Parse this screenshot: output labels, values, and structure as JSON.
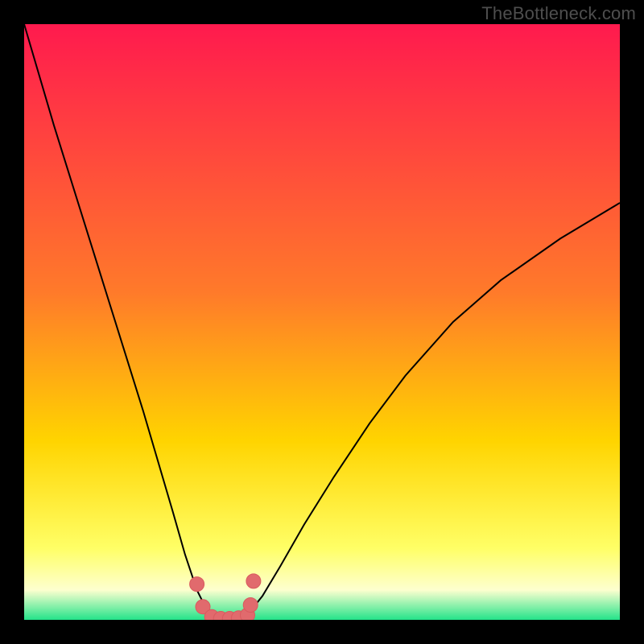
{
  "watermark": "TheBottleneck.com",
  "colors": {
    "frame": "#000000",
    "grad_top": "#ff1a4e",
    "grad_mid1": "#ff7a2a",
    "grad_mid2": "#ffd400",
    "grad_mid3": "#ffff66",
    "grad_bot1": "#fdffcf",
    "grad_bot2": "#24e38a",
    "curve": "#000000",
    "marker_fill": "#e16a6d",
    "marker_stroke": "#d95a5e"
  },
  "chart_data": {
    "type": "line",
    "title": "",
    "xlabel": "",
    "ylabel": "",
    "xlim": [
      0,
      100
    ],
    "ylim": [
      0,
      100
    ],
    "series": [
      {
        "name": "bottleneck-curve",
        "x": [
          0,
          5,
          10,
          15,
          20,
          25,
          27,
          29,
          30.5,
          32,
          33,
          34,
          35,
          36,
          37,
          38,
          40,
          43,
          47,
          52,
          58,
          64,
          72,
          80,
          90,
          100
        ],
        "values": [
          100,
          83,
          67,
          51,
          35,
          18,
          11,
          5,
          2,
          0.6,
          0.2,
          0.15,
          0.15,
          0.2,
          0.6,
          1.5,
          4,
          9,
          16,
          24,
          33,
          41,
          50,
          57,
          64,
          70
        ]
      }
    ],
    "markers": [
      {
        "x": 29.0,
        "y": 6.0
      },
      {
        "x": 30.0,
        "y": 2.2
      },
      {
        "x": 31.5,
        "y": 0.5
      },
      {
        "x": 33.0,
        "y": 0.2
      },
      {
        "x": 34.5,
        "y": 0.2
      },
      {
        "x": 36.0,
        "y": 0.3
      },
      {
        "x": 37.5,
        "y": 0.8
      },
      {
        "x": 38.0,
        "y": 2.5
      },
      {
        "x": 38.5,
        "y": 6.5
      }
    ],
    "gradient_bands": [
      {
        "y": 100,
        "color": "#ff1a4e"
      },
      {
        "y": 55,
        "color": "#ff7a2a"
      },
      {
        "y": 30,
        "color": "#ffd400"
      },
      {
        "y": 12,
        "color": "#ffff66"
      },
      {
        "y": 5,
        "color": "#fdffcf"
      },
      {
        "y": 0,
        "color": "#24e38a"
      }
    ]
  }
}
